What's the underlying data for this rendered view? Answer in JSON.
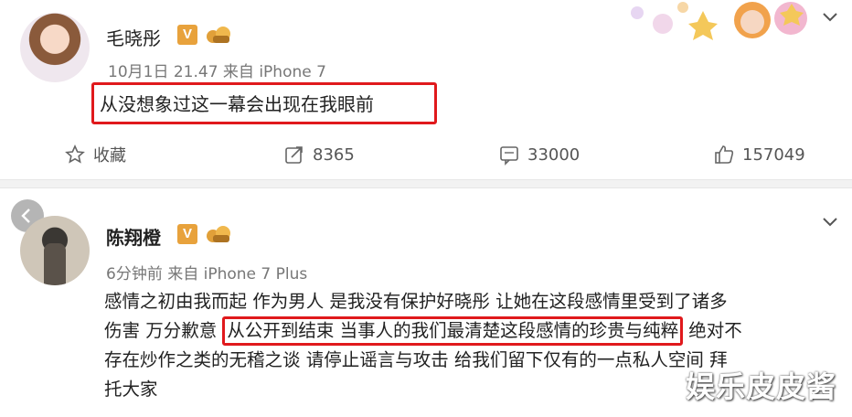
{
  "post1": {
    "username": "毛晓彤",
    "verified_badge": "V",
    "meta": "10月1日 21.47 来自 iPhone 7",
    "content": "从没想象过这一幕会出现在我眼前",
    "actions": {
      "favorite_label": "收藏",
      "repost_count": "8365",
      "comment_count": "33000",
      "like_count": "157049"
    },
    "menu_icon": "chevron-down-icon"
  },
  "post2": {
    "username": "陈翔橙",
    "verified_badge": "V",
    "meta": "6分钟前 来自 iPhone 7 Plus",
    "line1": "感情之初由我而起 作为男人 是我没有保护好晓彤 让她在这段感情里受到了诸多",
    "line2_before": "伤害 万分歉意 ",
    "line2_highlight": "从公开到结束 当事人的我们最清楚这段感情的珍贵与纯粹",
    "line2_after": " 绝对不",
    "line3": "存在炒作之类的无稽之谈 请停止谣言与攻击 给我们留下仅有的一点私人空间 拜",
    "line4": "托大家",
    "menu_icon": "chevron-down-icon"
  },
  "watermark": "娱乐皮皮酱",
  "colors": {
    "highlight_border": "#e0191c",
    "verified_badge": "#e8a23c",
    "separator": "#f2f2f2"
  }
}
